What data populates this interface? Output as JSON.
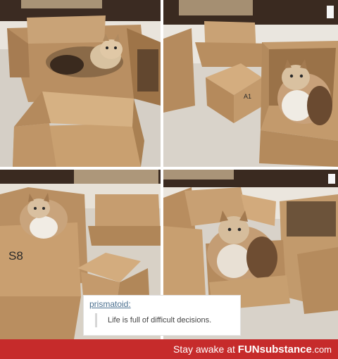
{
  "panels": [
    {
      "id": "panel-1"
    },
    {
      "id": "panel-2",
      "box_marking": "A1"
    },
    {
      "id": "panel-3",
      "box_marking": "S8"
    },
    {
      "id": "panel-4"
    }
  ],
  "caption": {
    "author": "prismatoid:",
    "quote": "Life is full of difficult decisions."
  },
  "footer": {
    "prefix": "Stay awake at ",
    "brand": "FUNsubstance",
    "domain": ".com"
  },
  "colors": {
    "footer_bg": "#c62b2b",
    "cardboard": "#c49a6c",
    "carpet": "#d8d2c8"
  }
}
